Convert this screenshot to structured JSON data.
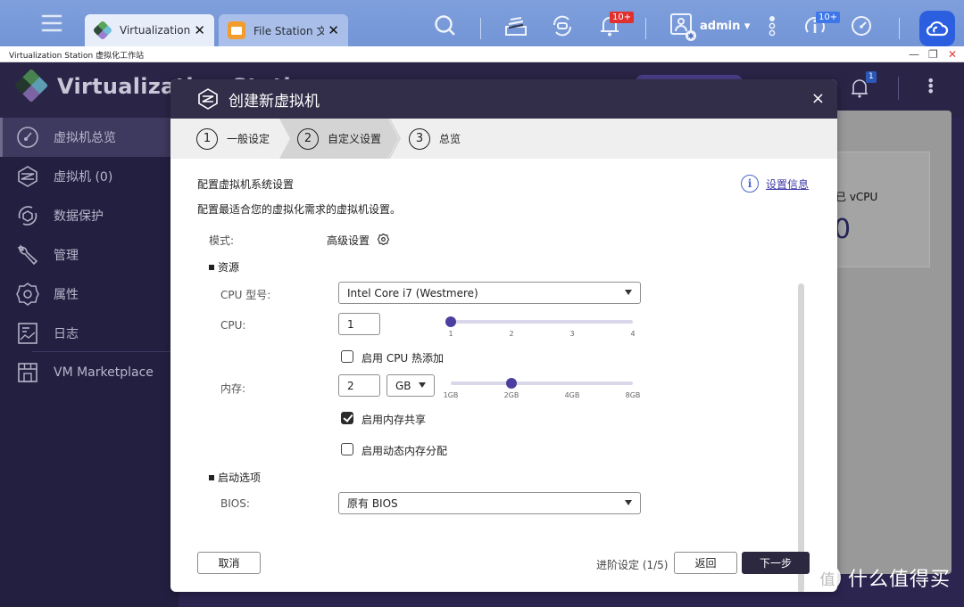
{
  "topbar": {
    "tabs": [
      {
        "label": "Virtualization ...",
        "icon": "virtualization-cube-icon",
        "active": true
      },
      {
        "label": "File Station 文...",
        "icon": "folder-icon",
        "active": false
      }
    ],
    "notification_badge": "10+",
    "user": "admin",
    "info_badge": "10+"
  },
  "window": {
    "title": "Virtualization Station 虚拟化工作站",
    "controls": {
      "minimize": "—",
      "restore": "❐",
      "close": "✕"
    }
  },
  "app": {
    "name": "Virtualization Station",
    "header_notification_badge": "1",
    "sidebar": [
      {
        "label": "虚拟机总览",
        "icon": "dashboard-gauge-icon",
        "active": true
      },
      {
        "label": "虚拟机 (0)",
        "icon": "vm-icon",
        "active": false
      },
      {
        "label": "数据保护",
        "icon": "data-protection-icon",
        "active": false
      },
      {
        "label": "管理",
        "icon": "wrench-icon",
        "active": false
      },
      {
        "label": "属性",
        "icon": "settings-gear-icon",
        "active": false
      },
      {
        "label": "日志",
        "icon": "log-icon",
        "active": false
      },
      {
        "label": "VM Marketplace",
        "icon": "store-icon",
        "active": false
      }
    ],
    "background_card": {
      "label": "已 vCPU",
      "value": "0"
    }
  },
  "modal": {
    "title": "创建新虚拟机",
    "close": "×",
    "steps": [
      {
        "num": "1",
        "label": "一般设定",
        "active": false
      },
      {
        "num": "2",
        "label": "自定义设置",
        "active": true
      },
      {
        "num": "3",
        "label": "总览",
        "active": false
      }
    ],
    "heading": "配置虚拟机系统设置",
    "subheading": "配置最适合您的虚拟化需求的虚拟机设置。",
    "info_link": "设置信息",
    "mode_label": "模式:",
    "mode_value": "高级设置",
    "resources_section": "资源",
    "cpu_model_label": "CPU 型号:",
    "cpu_model_value": "Intel Core i7 (Westmere)",
    "cpu_label": "CPU:",
    "cpu_value": "1",
    "cpu_slider": {
      "ticks": [
        "1",
        "2",
        "3",
        "4"
      ],
      "value_index": 0
    },
    "cpu_hotplug_label": "启用 CPU 热添加",
    "cpu_hotplug_checked": false,
    "memory_label": "内存:",
    "memory_value": "2",
    "memory_unit": "GB",
    "memory_slider": {
      "ticks": [
        "1GB",
        "2GB",
        "4GB",
        "8GB"
      ],
      "value_index": 1
    },
    "memory_sharing_label": "启用内存共享",
    "memory_sharing_checked": true,
    "dynamic_memory_label": "启用动态内存分配",
    "dynamic_memory_checked": false,
    "boot_section": "启动选项",
    "bios_label": "BIOS:",
    "bios_value": "原有 BIOS",
    "footer": {
      "cancel": "取消",
      "progress": "进阶设定 (1/5)",
      "back": "返回",
      "next": "下一步"
    }
  },
  "watermark": {
    "logo": "值",
    "text": "什么值得买"
  },
  "colors": {
    "topbar": "#7395d6",
    "app_bg": "#2a2446",
    "modal_header": "#322d48",
    "accent": "#4a3f9f",
    "primary_button": "#2c2840",
    "link": "#3f3aa8"
  }
}
